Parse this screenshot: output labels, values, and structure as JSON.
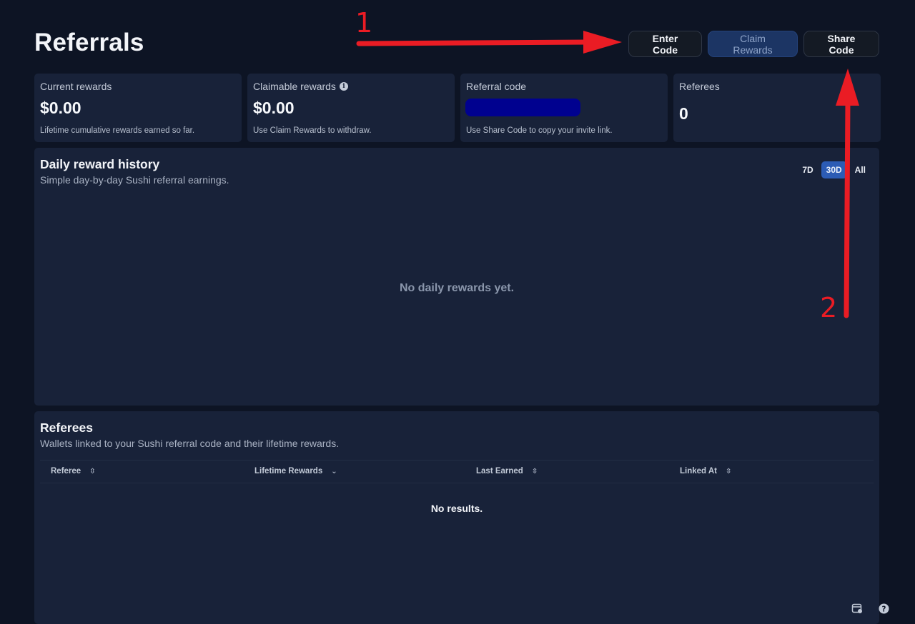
{
  "page": {
    "title": "Referrals"
  },
  "actions": {
    "enter_code": "Enter Code",
    "claim_rewards": "Claim Rewards",
    "share_code": "Share Code"
  },
  "stats": [
    {
      "label": "Current rewards",
      "value": "$0.00",
      "desc": "Lifetime cumulative rewards earned so far."
    },
    {
      "label": "Claimable rewards",
      "value": "$0.00",
      "desc": "Use Claim Rewards to withdraw.",
      "icon": "info-icon"
    },
    {
      "label": "Referral code",
      "value": "",
      "desc": "Use Share Code to copy your invite link.",
      "redaction_color": "#00018f"
    },
    {
      "label": "Referees",
      "value": "0",
      "desc": ""
    }
  ],
  "history": {
    "title": "Daily reward history",
    "subtitle": "Simple day-by-day Sushi referral earnings.",
    "ranges": [
      "7D",
      "30D",
      "All"
    ],
    "selected_range": "30D",
    "empty": "No daily rewards yet."
  },
  "referees": {
    "title": "Referees",
    "subtitle": "Wallets linked to your Sushi referral code and their lifetime rewards.",
    "columns": [
      {
        "label": "Referee",
        "sort": "unsorted"
      },
      {
        "label": "Lifetime Rewards",
        "sort": "descending"
      },
      {
        "label": "Last Earned",
        "sort": "unsorted"
      },
      {
        "label": "Linked At",
        "sort": "unsorted"
      }
    ],
    "empty": "No results."
  },
  "annotations": {
    "step1": "1",
    "step2": "2",
    "color": "#ea1c24"
  },
  "colors": {
    "background": "#0d1424",
    "card": "#182239",
    "accent": "#2c5cb5"
  },
  "icons": [
    "calendar-settings-icon",
    "help-icon"
  ]
}
